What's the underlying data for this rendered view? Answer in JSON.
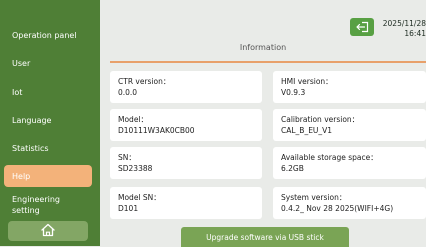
{
  "sidebar": {
    "items": [
      {
        "label": "Operation panel"
      },
      {
        "label": "User"
      },
      {
        "label": "Iot"
      },
      {
        "label": "Language"
      },
      {
        "label": "Statistics"
      },
      {
        "label": "Help"
      },
      {
        "label": "Engineering\nsetting"
      }
    ],
    "home_icon": "home-icon"
  },
  "header": {
    "date": "2025/11/28",
    "time": "16:41",
    "exit_icon": "exit-icon"
  },
  "main": {
    "title": "Information",
    "fields": {
      "ctr_version": {
        "label": "CTR version：",
        "value": "0.0.0"
      },
      "hmi_version": {
        "label": "HMI version：",
        "value": "V0.9.3"
      },
      "model": {
        "label": "Model：",
        "value": "D10111W3AK0CB00"
      },
      "calibration_version": {
        "label": "Calibration version：",
        "value": "CAL_B_EU_V1"
      },
      "sn": {
        "label": "SN：",
        "value": "SD23388"
      },
      "storage": {
        "label": "Available storage space：",
        "value": "6.2GB"
      },
      "model_sn": {
        "label": "Model SN：",
        "value": "D101"
      },
      "system_version": {
        "label": "System version：",
        "value": "0.4.2_ Nov 28 2025(WIFI+4G)"
      }
    },
    "upgrade_label": "Upgrade software via USB stick"
  },
  "colors": {
    "sidebar": "#4f7f36",
    "active": "#f3b27a",
    "accent_line": "#e8a06a",
    "button": "#7aa455"
  }
}
